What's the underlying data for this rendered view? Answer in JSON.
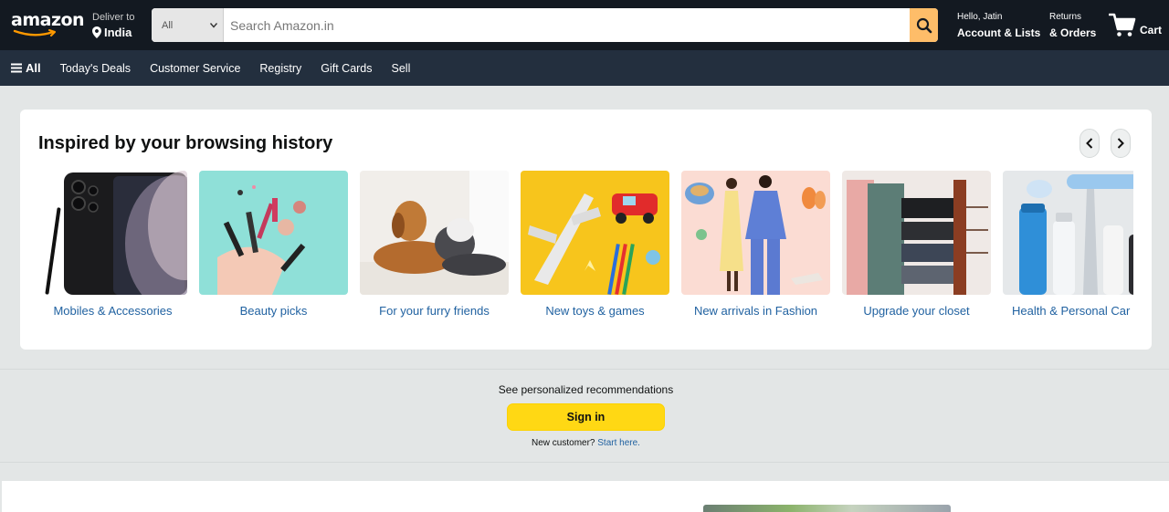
{
  "header": {
    "logo": "amazon",
    "deliver_label": "Deliver to",
    "deliver_location": "India",
    "search_category": "All",
    "search_placeholder": "Search Amazon.in",
    "account_greeting": "Hello, Jatin",
    "account_label": "Account & Lists",
    "returns_label": "Returns",
    "orders_label": "& Orders",
    "cart_label": "Cart",
    "icons": [
      "location-pin-icon",
      "search-icon",
      "cart-icon",
      "chevron-down-icon"
    ]
  },
  "nav": {
    "all_label": "All",
    "links": [
      "Today's Deals",
      "Customer Service",
      "Registry",
      "Gift Cards",
      "Sell"
    ]
  },
  "browsing": {
    "title": "Inspired by your browsing history",
    "items": [
      {
        "label": "Mobiles & Accessories"
      },
      {
        "label": "Beauty picks"
      },
      {
        "label": "For your furry friends"
      },
      {
        "label": "New toys & games"
      },
      {
        "label": "New arrivals in Fashion"
      },
      {
        "label": "Upgrade your closet"
      },
      {
        "label": "Health & Personal Car"
      }
    ]
  },
  "signin": {
    "prompt": "See personalized recommendations",
    "button": "Sign in",
    "new_customer": "New customer?",
    "start_here": "Start here."
  },
  "colors": {
    "header_bg": "#131921",
    "nav_bg": "#232f3e",
    "search_button": "#febd69",
    "signin_button": "#ffd814",
    "link": "#2162a1",
    "page_bg": "#e3e6e6"
  }
}
